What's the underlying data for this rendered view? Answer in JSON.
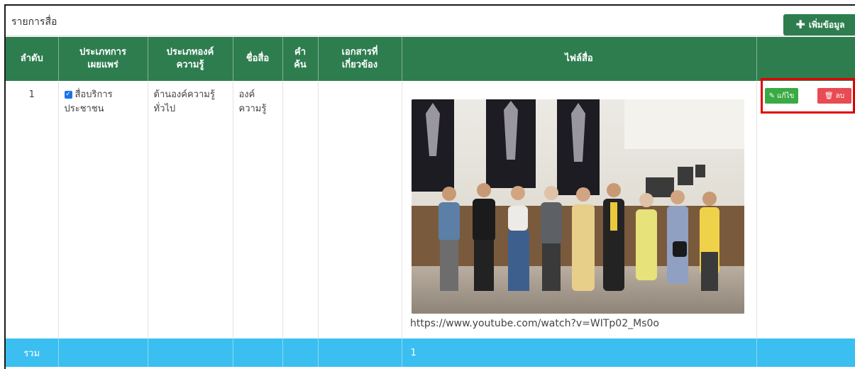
{
  "panel": {
    "title": "รายการสื่อ",
    "add_button": "เพิ่มข้อมูล"
  },
  "table": {
    "headers": [
      "ลำดับ",
      "ประเภทการเผยแพร่",
      "ประเภทองค์ความรู้",
      "ชื่อสื่อ",
      "คำค้น",
      "เอกสารที่เกี่ยวข้อง",
      "ไฟล์สื่อ",
      ""
    ],
    "header_lines": {
      "col2": [
        "ประเภทการ",
        "เผยแพร่"
      ],
      "col3": [
        "ประเภทองค์",
        "ความรู้"
      ],
      "col5": [
        "คำ",
        "ค้น"
      ],
      "col6": [
        "เอกสารที่",
        "เกี่ยวข้อง"
      ]
    },
    "row": {
      "number": "1",
      "publish_type_line1": "สื่อบริการ",
      "publish_type_line2": "ประชาชน",
      "publish_checked": true,
      "knowledge_line1": "ด้านองค์ความรู้",
      "knowledge_line2": "ทั่วไป",
      "media_name_line1": "องค์",
      "media_name_line2": "ความรู้",
      "keywords": "",
      "documents": "",
      "media_url": "https://www.youtube.com/watch?v=WITp02_Ms0o",
      "edit_label": "แก้ไข",
      "delete_label": "ลบ"
    },
    "footer": {
      "label": "รวม",
      "count": "1"
    }
  },
  "colors": {
    "header_green": "#2e7d4f",
    "footer_blue": "#3bbff0",
    "edit_green": "#3aaa44",
    "delete_red": "#e84b52",
    "highlight_red": "#e00000"
  }
}
